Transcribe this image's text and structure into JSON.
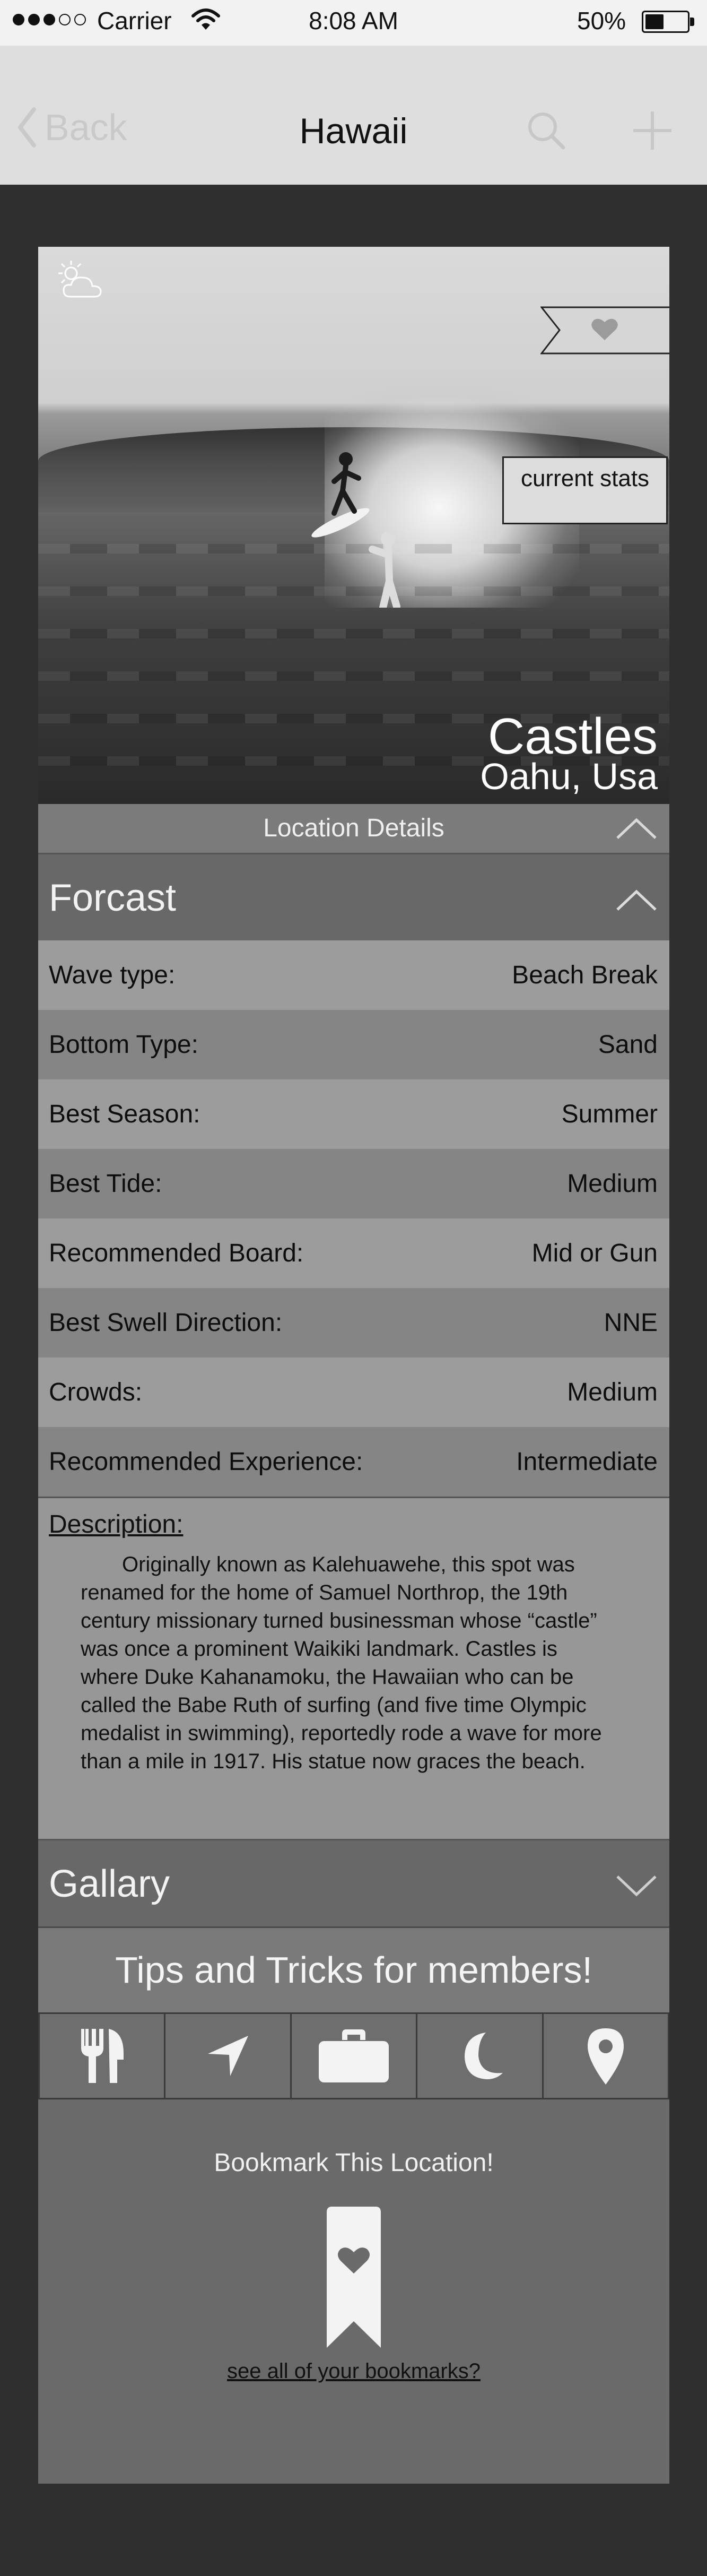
{
  "status_bar": {
    "carrier": "Carrier",
    "time": "8:08 AM",
    "battery_percent": "50%",
    "battery_level": 0.5,
    "signal_bars_filled": 3,
    "signal_bars_total": 5
  },
  "nav": {
    "back_label": "Back",
    "title": "Hawaii",
    "search_icon": "search-icon",
    "add_icon": "plus-icon"
  },
  "hero": {
    "weather_icon": "partly-cloudy-icon",
    "favorite_icon": "heart-icon",
    "current_stats_label": "current stats",
    "location_name": "Castles",
    "location_region": "Oahu, Usa"
  },
  "location_details": {
    "label": "Location Details"
  },
  "forecast": {
    "heading": "Forcast",
    "rows": [
      {
        "label": "Wave type:",
        "value": "Beach Break"
      },
      {
        "label": "Bottom Type:",
        "value": "Sand"
      },
      {
        "label": "Best Season:",
        "value": "Summer"
      },
      {
        "label": "Best Tide:",
        "value": "Medium"
      },
      {
        "label": "Recommended Board:",
        "value": "Mid or Gun"
      },
      {
        "label": "Best Swell Direction:",
        "value": "NNE"
      },
      {
        "label": "Crowds:",
        "value": "Medium"
      },
      {
        "label": "Recommended Experience:",
        "value": "Intermediate"
      }
    ]
  },
  "description": {
    "heading": "Description:",
    "text": "Originally known as Kalehuawehe, this spot was renamed for the home of Samuel Northrop, the 19th century missionary turned businessman whose “castle” was once a prominent Waikiki landmark. Castles is where Duke Kahanamoku, the Hawaiian who can be called the Babe Ruth of surfing (and five time Olympic medalist in swimming), reportedly rode a wave for more than a mile in 1917. His statue now graces the beach."
  },
  "gallery": {
    "heading": "Gallary"
  },
  "tips": {
    "label": "Tips and Tricks for members!",
    "icons": [
      "fork-knife-icon",
      "navigation-arrow-icon",
      "briefcase-icon",
      "moon-icon",
      "map-pin-icon"
    ]
  },
  "bookmark": {
    "title": "Bookmark This Location!",
    "link": "see all of your bookmarks?",
    "icon": "bookmark-heart-icon"
  },
  "colors": {
    "background": "#2f2f2f",
    "navbar": "#dedede",
    "row_light": "#9c9c9c",
    "row_dark": "#858585",
    "section_header": "#686868"
  }
}
